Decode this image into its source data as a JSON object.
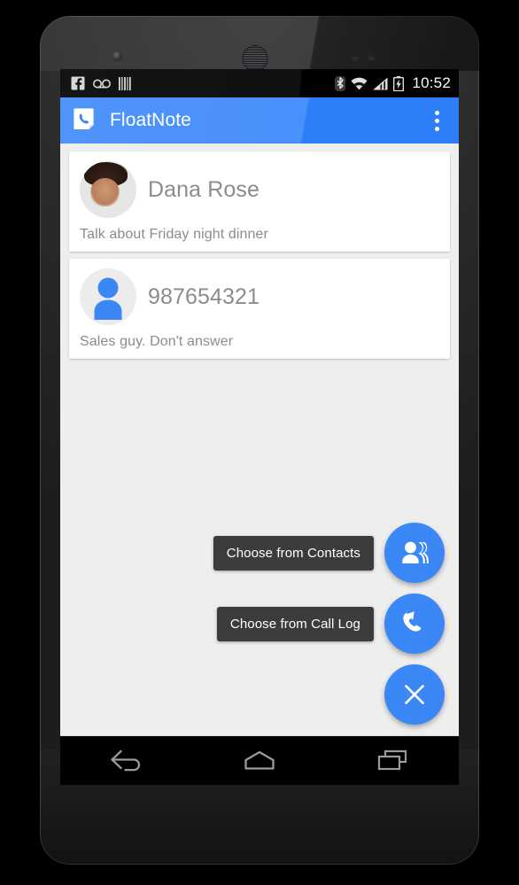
{
  "device": {
    "name": "android-phone",
    "hardware": {
      "front_camera": "front-camera",
      "earpiece": "earpiece-speaker",
      "sensors": "proximity-sensors"
    }
  },
  "status_bar": {
    "notification_icons": [
      "facebook-icon",
      "voicemail-icon",
      "barcode-icon"
    ],
    "system_icons": [
      "bluetooth-icon",
      "wifi-icon",
      "cellular-signal-icon",
      "battery-charging-icon"
    ],
    "clock": "10:52"
  },
  "app_bar": {
    "icon": "floatnote-app-icon",
    "title": "FloatNote",
    "overflow_icon": "overflow-menu-icon",
    "background_color": "#4a90fa"
  },
  "notes": [
    {
      "avatar_type": "photo",
      "title": "Dana Rose",
      "body": "Talk about Friday night dinner"
    },
    {
      "avatar_type": "default-person",
      "title": "987654321",
      "body": "Sales guy. Don't answer"
    }
  ],
  "fab_menu": {
    "accent_color": "#3b87f5",
    "actions": [
      {
        "label": "Choose from Contacts",
        "icon": "contacts-icon"
      },
      {
        "label": "Choose from Call Log",
        "icon": "call-log-icon"
      }
    ],
    "main": {
      "label": "Close menu",
      "icon": "close-icon"
    }
  },
  "nav_bar": {
    "buttons": [
      {
        "name": "back-button",
        "icon": "back-arrow-icon"
      },
      {
        "name": "home-button",
        "icon": "home-icon"
      },
      {
        "name": "recents-button",
        "icon": "recents-icon"
      }
    ]
  }
}
